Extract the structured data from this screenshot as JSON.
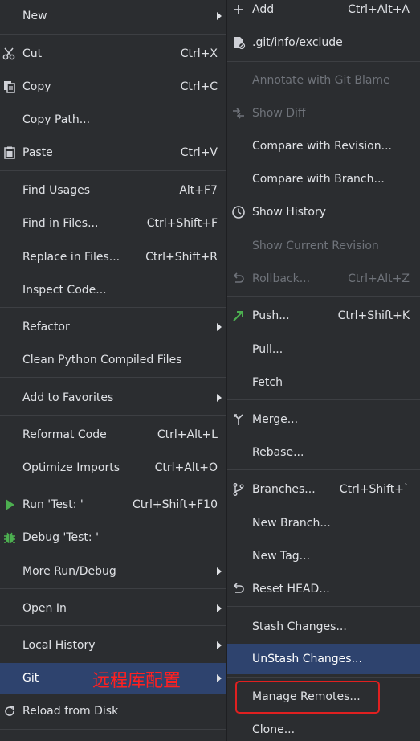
{
  "left_menu": {
    "items": [
      {
        "label": "New"
      },
      {
        "label": "Cut",
        "shortcut": "Ctrl+X"
      },
      {
        "label": "Copy",
        "shortcut": "Ctrl+C"
      },
      {
        "label": "Copy Path..."
      },
      {
        "label": "Paste",
        "shortcut": "Ctrl+V"
      },
      {
        "label": "Find Usages",
        "shortcut": "Alt+F7"
      },
      {
        "label": "Find in Files...",
        "shortcut": "Ctrl+Shift+F"
      },
      {
        "label": "Replace in Files...",
        "shortcut": "Ctrl+Shift+R"
      },
      {
        "label": "Inspect Code..."
      },
      {
        "label": "Refactor"
      },
      {
        "label": "Clean Python Compiled Files"
      },
      {
        "label": "Add to Favorites"
      },
      {
        "label": "Reformat Code",
        "shortcut": "Ctrl+Alt+L"
      },
      {
        "label": "Optimize Imports",
        "shortcut": "Ctrl+Alt+O"
      },
      {
        "label": "Run 'Test: '",
        "shortcut": "Ctrl+Shift+F10"
      },
      {
        "label": "Debug 'Test: '"
      },
      {
        "label": "More Run/Debug"
      },
      {
        "label": "Open In"
      },
      {
        "label": "Local History"
      },
      {
        "label": "Git"
      },
      {
        "label": "Reload from Disk"
      }
    ]
  },
  "right_menu": {
    "items": [
      {
        "label": "Add",
        "shortcut": "Ctrl+Alt+A"
      },
      {
        "label": ".git/info/exclude"
      },
      {
        "label": "Annotate with Git Blame"
      },
      {
        "label": "Show Diff"
      },
      {
        "label": "Compare with Revision..."
      },
      {
        "label": "Compare with Branch..."
      },
      {
        "label": "Show History"
      },
      {
        "label": "Show Current Revision"
      },
      {
        "label": "Rollback...",
        "shortcut": "Ctrl+Alt+Z"
      },
      {
        "label": "Push...",
        "shortcut": "Ctrl+Shift+K"
      },
      {
        "label": "Pull..."
      },
      {
        "label": "Fetch"
      },
      {
        "label": "Merge..."
      },
      {
        "label": "Rebase..."
      },
      {
        "label": "Branches...",
        "shortcut": "Ctrl+Shift+`"
      },
      {
        "label": "New Branch..."
      },
      {
        "label": "New Tag..."
      },
      {
        "label": "Reset HEAD..."
      },
      {
        "label": "Stash Changes..."
      },
      {
        "label": "UnStash Changes..."
      },
      {
        "label": "Manage Remotes..."
      },
      {
        "label": "Clone..."
      }
    ]
  },
  "annotation": {
    "text": "远程库配置"
  },
  "colors": {
    "background": "#2b2d30",
    "selected": "#2e436e",
    "disabled_text": "#6f737a",
    "annotation_red": "#ff2020",
    "run_green": "#4caf50",
    "push_green": "#4caf50"
  },
  "icons": {
    "cut": "scissors-icon",
    "copy": "copy-icon",
    "paste": "clipboard-icon",
    "run": "play-icon",
    "debug": "bug-icon",
    "reload": "refresh-icon",
    "add": "plus-icon",
    "exclude": "git-ignore-icon",
    "diff": "diff-icon",
    "history": "clock-icon",
    "rollback": "undo-icon",
    "push": "arrow-up-right-icon",
    "merge": "merge-icon",
    "branches": "branch-icon",
    "reset": "undo-icon"
  }
}
